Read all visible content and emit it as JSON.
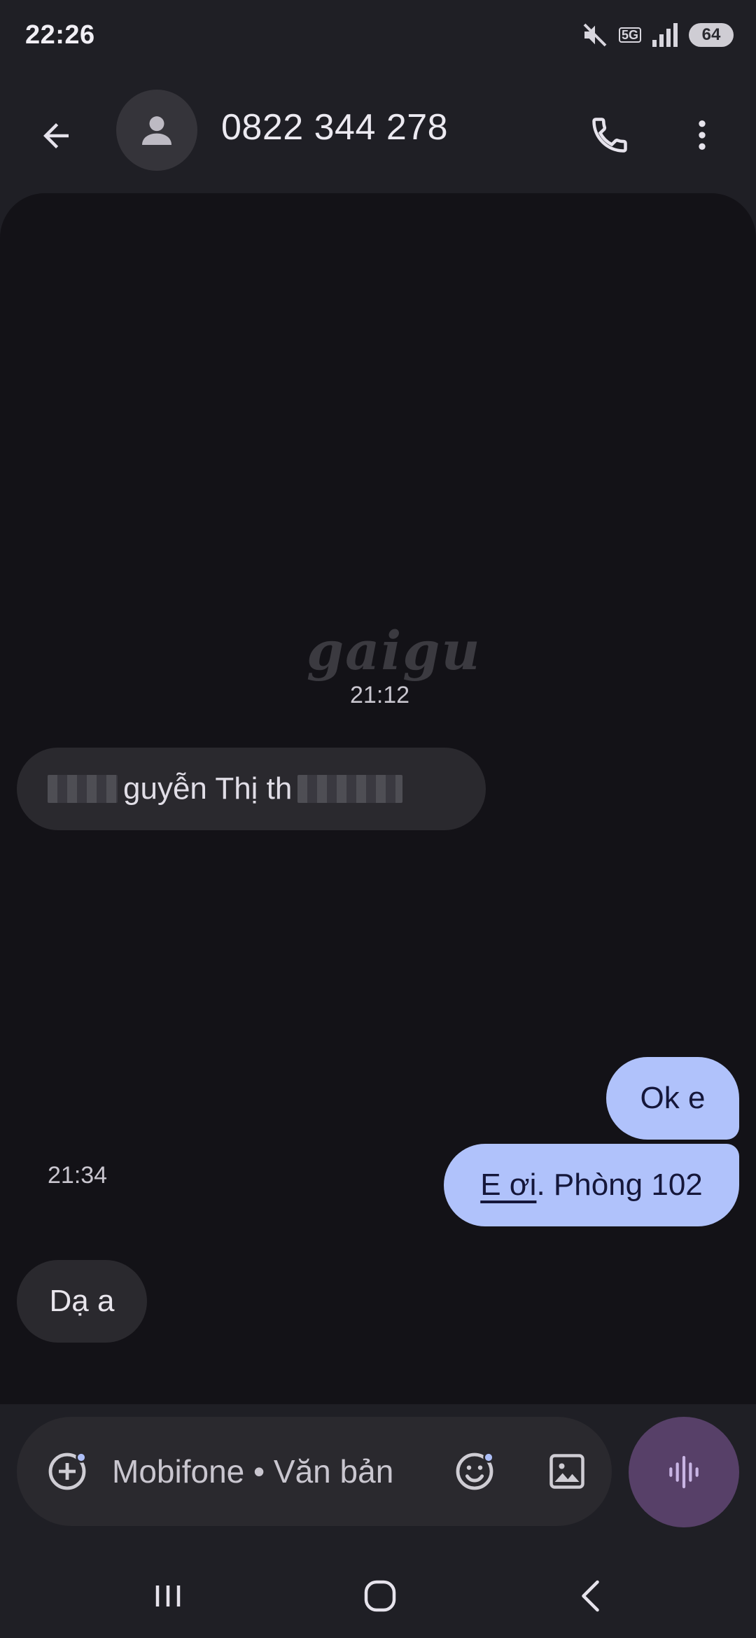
{
  "status_bar": {
    "time": "22:26",
    "network": "5G",
    "battery": "64",
    "icons": [
      "mute-icon",
      "network-5g-icon",
      "signal-icon",
      "battery-icon"
    ]
  },
  "app_bar": {
    "contact": "0822 344 278",
    "icons": [
      "arrow-back-icon",
      "person-icon",
      "phone-icon",
      "more-vert-icon"
    ]
  },
  "conversation": {
    "watermark": "gaigu",
    "timestamp_1": "21:12",
    "messages": [
      {
        "direction": "incoming",
        "text_visible": "guyễn Thị th",
        "note_blurred": true
      },
      {
        "direction": "outgoing",
        "text": "Ok e"
      },
      {
        "direction": "outgoing",
        "link_text": "E ơi",
        "text": ". Phòng 102"
      },
      {
        "direction": "incoming",
        "text": "Dạ a"
      }
    ],
    "timestamp_2": "21:34"
  },
  "compose": {
    "placeholder": "Mobifone • Văn bản",
    "icons": [
      "add-circle-icon",
      "emoji-icon",
      "image-icon",
      "voice-waveform-icon"
    ]
  },
  "colors": {
    "background": "#1f1f25",
    "conversation_bg": "#131217",
    "bubble_incoming": "#2a292e",
    "bubble_outgoing": "#b0c2fb",
    "voice_button": "#574068",
    "accent_dot": "#aebff8"
  }
}
